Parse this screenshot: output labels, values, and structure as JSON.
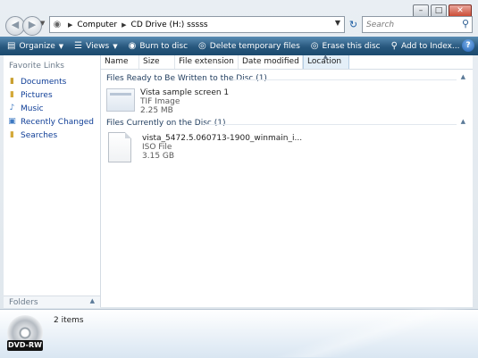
{
  "window": {
    "controls": [
      "minimize",
      "maximize",
      "close"
    ]
  },
  "nav": {
    "back_icon": "back-arrow-icon",
    "forward_icon": "forward-arrow-icon"
  },
  "address": {
    "crumbs": [
      "Computer",
      "CD Drive (H:) sssss"
    ]
  },
  "search": {
    "placeholder": "Search"
  },
  "toolbar": {
    "organize": "Organize",
    "views": "Views",
    "burn": "Burn to disc",
    "delete_temp": "Delete temporary files",
    "erase": "Erase this disc",
    "add_index": "Add to Index..."
  },
  "sidebar": {
    "title": "Favorite Links",
    "items": [
      {
        "label": "Documents",
        "icon": "documents-icon"
      },
      {
        "label": "Pictures",
        "icon": "pictures-icon"
      },
      {
        "label": "Music",
        "icon": "music-icon"
      },
      {
        "label": "Recently Changed",
        "icon": "recently-changed-icon"
      },
      {
        "label": "Searches",
        "icon": "searches-icon"
      }
    ],
    "folders_label": "Folders"
  },
  "columns": [
    "Name",
    "Size",
    "File extension",
    "Date modified",
    "Location"
  ],
  "groups": [
    {
      "title": "Files Ready to Be Written to the Disc (1)",
      "files": [
        {
          "name": "Vista sample screen 1",
          "type": "TIF Image",
          "size": "2.25 MB"
        }
      ]
    },
    {
      "title": "Files Currently on the Disc (1)",
      "files": [
        {
          "name": "vista_5472.5.060713-1900_winmain_i...",
          "type": "ISO File",
          "size": "3.15 GB"
        }
      ]
    }
  ],
  "details": {
    "drive_label": "DVD-RW",
    "item_count": "2 items"
  }
}
